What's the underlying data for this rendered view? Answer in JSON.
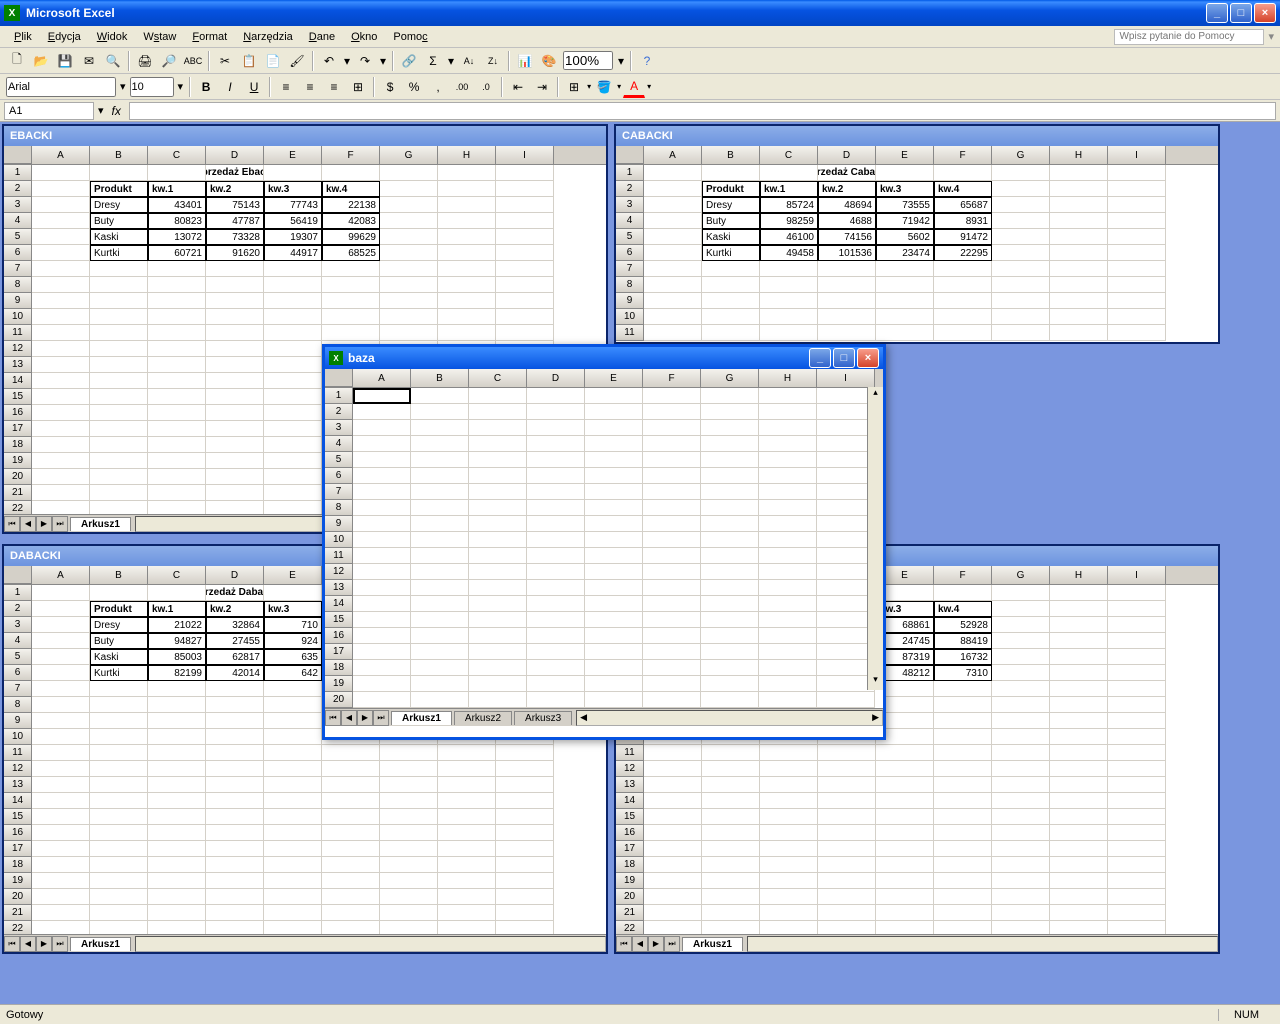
{
  "app": {
    "title": "Microsoft Excel"
  },
  "menu": {
    "items": [
      "Plik",
      "Edycja",
      "Widok",
      "Wstaw",
      "Format",
      "Narzędzia",
      "Dane",
      "Okno",
      "Pomoc"
    ],
    "help_placeholder": "Wpisz pytanie do Pomocy"
  },
  "format": {
    "font": "Arial",
    "size": "10"
  },
  "formula": {
    "namebox": "A1"
  },
  "toolbar": {
    "zoom": "100%"
  },
  "status": {
    "text": "Gotowy",
    "indicator": "NUM"
  },
  "columns": [
    "A",
    "B",
    "C",
    "D",
    "E",
    "F",
    "G",
    "H",
    "I"
  ],
  "windows": {
    "ebacki": {
      "title": "EBACKI",
      "sheet": "Arkusz1",
      "heading": "Sprzedaż Ebacki",
      "headers": [
        "Produkt",
        "kw.1",
        "kw.2",
        "kw.3",
        "kw.4"
      ],
      "rows": [
        [
          "Dresy",
          "43401",
          "75143",
          "77743",
          "22138"
        ],
        [
          "Buty",
          "80823",
          "47787",
          "56419",
          "42083"
        ],
        [
          "Kaski",
          "13072",
          "73328",
          "19307",
          "99629"
        ],
        [
          "Kurtki",
          "60721",
          "91620",
          "44917",
          "68525"
        ]
      ]
    },
    "cabacki": {
      "title": "CABACKI",
      "sheet": "Arkusz1",
      "heading": "Sprzedaż Cabacki",
      "headers": [
        "Produkt",
        "kw.1",
        "kw.2",
        "kw.3",
        "kw.4"
      ],
      "rows": [
        [
          "Dresy",
          "85724",
          "48694",
          "73555",
          "65687"
        ],
        [
          "Buty",
          "98259",
          "4688",
          "71942",
          "8931"
        ],
        [
          "Kaski",
          "46100",
          "74156",
          "5602",
          "91472"
        ],
        [
          "Kurtki",
          "49458",
          "101536",
          "23474",
          "22295"
        ]
      ]
    },
    "dabacki": {
      "title": "DABACKI",
      "sheet": "Arkusz1",
      "heading": "Sprzedaż Dabacki",
      "headers": [
        "Produkt",
        "kw.1",
        "kw.2",
        "kw.3"
      ],
      "rows": [
        [
          "Dresy",
          "21022",
          "32864",
          "710"
        ],
        [
          "Buty",
          "94827",
          "27455",
          "924"
        ],
        [
          "Kaski",
          "85003",
          "62817",
          "635"
        ],
        [
          "Kurtki",
          "82199",
          "42014",
          "642"
        ]
      ]
    },
    "hidden_right": {
      "headers": [
        "kw.3",
        "kw.4"
      ],
      "rows": [
        [
          "68861",
          "52928"
        ],
        [
          "24745",
          "88419"
        ],
        [
          "87319",
          "16732"
        ],
        [
          "48212",
          "7310"
        ]
      ]
    },
    "baza": {
      "title": "baza",
      "sheets": [
        "Arkusz1",
        "Arkusz2",
        "Arkusz3"
      ]
    }
  }
}
